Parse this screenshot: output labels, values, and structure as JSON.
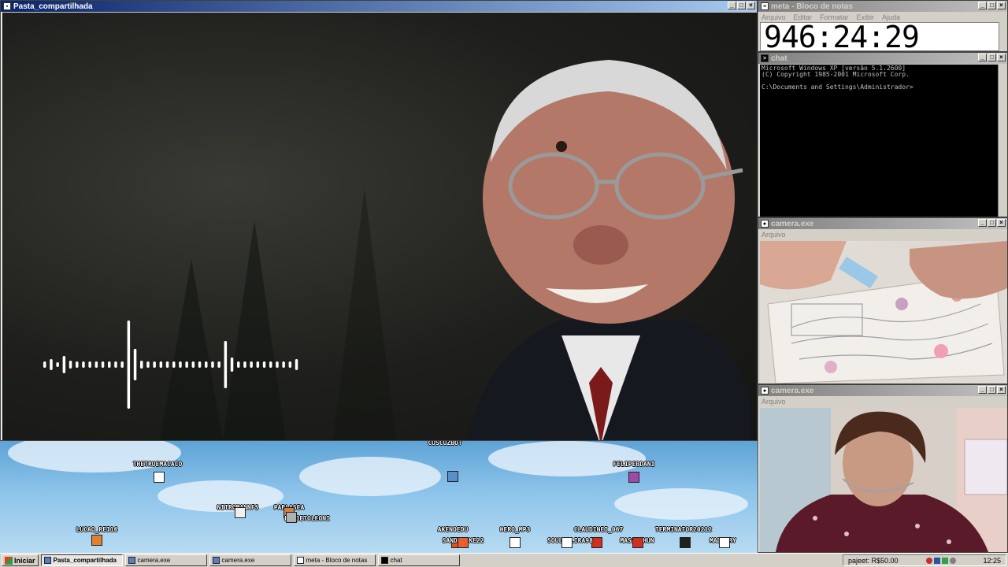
{
  "windows": {
    "video": {
      "title": "Pasta_compartilhada"
    },
    "notepad": {
      "title": "meta - Bloco de notas",
      "menu": [
        "Arquivo",
        "Editar",
        "Formatar",
        "Exibir",
        "Ajuda"
      ],
      "content": "946:24:29"
    },
    "cmd": {
      "title": "chat",
      "lines": "Microsoft Windows XP [versão 5.1.2600]\n(C) Copyright 1985-2001 Microsoft Corp.\n\nC:\\Documents and Settings\\Administrador>"
    },
    "cam1": {
      "title": "camera.exe",
      "menu": "Arquivo"
    },
    "cam2": {
      "title": "camera.exe",
      "menu": "Arquivo"
    }
  },
  "chat_users": [
    {
      "name": "CUSCUZBOT",
      "color": "#5a8fc8"
    },
    {
      "name": "THETRUEMACACO",
      "color": "#ffffff"
    },
    {
      "name": "FELIPEBDANI",
      "color": "#a04aa8"
    },
    {
      "name": "NITROMANNFS",
      "color": "#f0f0f0"
    },
    {
      "name": "PARLASEA",
      "color": "#d08040"
    },
    {
      "name": "PAGJETOLEONI",
      "color": "#b0b0b0"
    },
    {
      "name": "LUCAO_REI16",
      "color": "#e08030"
    },
    {
      "name": "AKENOEDU",
      "color": "#e05020"
    },
    {
      "name": "SANDSLIKE22",
      "color": "#e86030"
    },
    {
      "name": "HERO_MP3",
      "color": "#ffffff"
    },
    {
      "name": "CLAUDINEI_067",
      "color": "#d03020"
    },
    {
      "name": "SOULVALIRA98",
      "color": "#ffffff"
    },
    {
      "name": "MASAMUHUN",
      "color": "#d03020"
    },
    {
      "name": "TERMINATOR20212",
      "color": "#202020"
    },
    {
      "name": "MADG2RY",
      "color": "#ffffff"
    }
  ],
  "taskbar": {
    "start_label": "Iniciar",
    "tasks": [
      {
        "label": "Pasta_compartilhada",
        "active": true
      },
      {
        "label": "camera.exe",
        "active": false
      },
      {
        "label": "camera.exe",
        "active": false
      },
      {
        "label": "meta - Bloco de notas",
        "active": false
      },
      {
        "label": "chat",
        "active": false
      }
    ],
    "tray_text": "pajeet: R$50.00",
    "clock": "12:25"
  }
}
